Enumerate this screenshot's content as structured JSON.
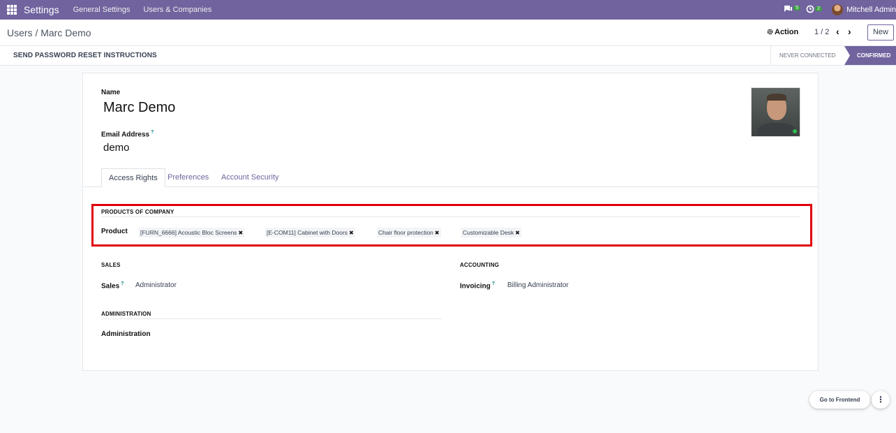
{
  "navbar": {
    "brand": "Settings",
    "menus": [
      "General Settings",
      "Users & Companies"
    ],
    "chat_count": "5",
    "activity_count": "2",
    "user_name": "Mitchell Admin",
    "bg_color": "#71639e"
  },
  "control": {
    "breadcrumb": "Users / Marc Demo",
    "action_label": "Action",
    "pager": "1 / 2",
    "new_label": "New"
  },
  "statusbar": {
    "reset_label": "SEND PASSWORD RESET INSTRUCTIONS",
    "stages": [
      "NEVER CONNECTED",
      "CONFIRMED"
    ],
    "active_stage": "CONFIRMED"
  },
  "form": {
    "name_label": "Name",
    "name_value": "Marc Demo",
    "email_label": "Email Address",
    "email_value": "demo",
    "help_mark": "?",
    "tabs": [
      "Access Rights",
      "Preferences",
      "Account Security"
    ],
    "active_tab": "Access Rights",
    "products_section": {
      "title": "PRODUCTS OF COMPANY",
      "field_label": "Product",
      "tags": [
        "[FURN_6666] Acoustic Bloc Screens",
        "[E-COM11] Cabinet with Doors",
        "Chair floor protection",
        "Customizable Desk"
      ]
    },
    "sales_section": {
      "title": "SALES",
      "field_label": "Sales",
      "field_value": "Administrator"
    },
    "accounting_section": {
      "title": "ACCOUNTING",
      "field_label": "Invoicing",
      "field_value": "Billing Administrator"
    },
    "administration_section": {
      "title": "ADMINISTRATION",
      "field_label": "Administration"
    }
  },
  "floating": {
    "frontend_label": "Go to Frontend",
    "more_icon": "⋮"
  },
  "icons": {
    "apps": "apps-grid-icon",
    "chat": "chat-icon",
    "activity": "clock-icon",
    "gear": "gear-icon",
    "prev": "chevron-left-icon",
    "next": "chevron-right-icon",
    "remove": "close-icon"
  }
}
